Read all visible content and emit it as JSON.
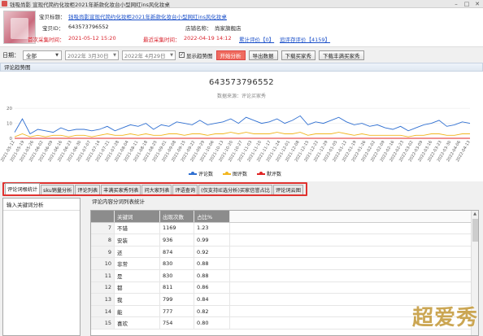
{
  "window": {
    "title": "钱吸尚影 宣现代简约化妆柜2021年新款化妆台小型网红ins风化妆桌"
  },
  "product": {
    "label_name": "宝贝标题：",
    "name": "钱吸尚影宣现代简约化妆柜2021年新款化妆台小型网红ins风化妆桌",
    "label_id": "宝贝ID：",
    "id": "643573796552",
    "label_shop": "店铺名称：",
    "shop": "尚家旗舰店",
    "label_first": "首次采集时间：",
    "first_time": "2021-05-12 15:20",
    "label_last": "最近采集时间：",
    "last_time": "2022-04-19 14:12",
    "review_link": "累计评价【0】",
    "ask_link": "追评存评价【4159】"
  },
  "toolbar": {
    "date_label": "日期：",
    "range_select": "全部",
    "date_start": "2022年 3月30日",
    "date_end": "2022年 4月29日",
    "show_trend_label": "显示趋势图",
    "show_trend_checked": true,
    "start_btn": "开始分析",
    "export_btn": "导出数据",
    "download_buyers_btn": "下载买家秀",
    "download_buyers_more_btn": "下载丰满买家秀"
  },
  "chart_section": {
    "title": "评论趋势图"
  },
  "chart_data": {
    "type": "line",
    "title": "643573796552",
    "subtitle": "数据来源：评论买家秀",
    "x_start": "2021-05-12",
    "x_end": "2022-04-13",
    "x_tick_labels": [
      "2021-05-12",
      "2021-05-19",
      "2021-05-26",
      "2021-06-02",
      "2021-06-09",
      "2021-06-16",
      "2021-06-23",
      "2021-06-30",
      "2021-07-07",
      "2021-07-14",
      "2021-07-21",
      "2021-07-28",
      "2021-08-04",
      "2021-08-11",
      "2021-08-18",
      "2021-08-25",
      "2021-09-01",
      "2021-09-08",
      "2021-09-15",
      "2021-09-22",
      "2021-09-29",
      "2021-10-06",
      "2021-10-13",
      "2021-10-20",
      "2021-10-27",
      "2021-11-03",
      "2021-11-10",
      "2021-11-17",
      "2021-11-24",
      "2021-12-01",
      "2021-12-08",
      "2021-12-15",
      "2021-12-22",
      "2021-12-29",
      "2022-01-05",
      "2022-01-12",
      "2022-01-19",
      "2022-01-26",
      "2022-02-02",
      "2022-02-09",
      "2022-02-16",
      "2022-02-23",
      "2022-03-02",
      "2022-03-09",
      "2022-03-16",
      "2022-03-23",
      "2022-03-30",
      "2022-04-06",
      "2022-04-13"
    ],
    "y_tick_labels": [
      "0",
      "10",
      "20"
    ],
    "ylim": [
      0,
      25
    ],
    "legend": "bottom",
    "series": [
      {
        "name": "评论数",
        "color": "#2f6fd1",
        "values": [
          4,
          13,
          3,
          6,
          5,
          4,
          7,
          5,
          6,
          6,
          5,
          6,
          8,
          5,
          7,
          9,
          8,
          10,
          6,
          9,
          8,
          11,
          10,
          9,
          12,
          9,
          10,
          11,
          13,
          10,
          14,
          12,
          10,
          11,
          13,
          10,
          12,
          15,
          9,
          11,
          10,
          12,
          14,
          11,
          9,
          10,
          8,
          9,
          7,
          6,
          8,
          5,
          7,
          9,
          10,
          12,
          8,
          9,
          11,
          10
        ]
      },
      {
        "name": "图评数",
        "color": "#f2b61f",
        "values": [
          1,
          3,
          1,
          2,
          1,
          2,
          2,
          1,
          2,
          2,
          1,
          2,
          3,
          2,
          2,
          3,
          2,
          3,
          2,
          2,
          3,
          3,
          2,
          3,
          3,
          2,
          3,
          3,
          4,
          3,
          4,
          3,
          3,
          3,
          4,
          3,
          3,
          4,
          2,
          3,
          3,
          3,
          4,
          3,
          2,
          3,
          2,
          2,
          2,
          2,
          2,
          1,
          2,
          2,
          3,
          3,
          2,
          2,
          3,
          3
        ]
      },
      {
        "name": "默评数",
        "color": "#e02424",
        "values": [
          0,
          0,
          0,
          0,
          0,
          0,
          0,
          0,
          0,
          0,
          0,
          0,
          0,
          0,
          0,
          0,
          0,
          0,
          0,
          0,
          0,
          0,
          0,
          0,
          0,
          0,
          0,
          0,
          0,
          0,
          0,
          0,
          0,
          0,
          0,
          0,
          0,
          0,
          0,
          0,
          0,
          0,
          0,
          0,
          0,
          0,
          0,
          0,
          0,
          0,
          0,
          0,
          0,
          0,
          0,
          0,
          0,
          0,
          0,
          0
        ]
      }
    ]
  },
  "tabs": [
    {
      "label": "评论词根统计",
      "active": true
    },
    {
      "label": "sku销量分析",
      "active": false
    },
    {
      "label": "评论列表",
      "active": false
    },
    {
      "label": "丰满买家秀列表",
      "active": false
    },
    {
      "label": "问大家列表",
      "active": false
    },
    {
      "label": "评语查询",
      "active": false
    },
    {
      "label": "(仅支持IE选分析)买家信誉占比",
      "active": false
    },
    {
      "label": "评论词云图",
      "active": false
    }
  ],
  "left_panel": {
    "title": "输入关键词分析"
  },
  "right_panel": {
    "title": "评论内容分词列表统计",
    "columns": [
      "",
      "关键词",
      "出现次数",
      "占比%"
    ],
    "rows": [
      [
        "7",
        "不错",
        "1169",
        "1.23"
      ],
      [
        "8",
        "安装",
        "936",
        "0.99"
      ],
      [
        "9",
        "还",
        "874",
        "0.92"
      ],
      [
        "10",
        "非常",
        "830",
        "0.88"
      ],
      [
        "11",
        "是",
        "830",
        "0.88"
      ],
      [
        "12",
        "都",
        "811",
        "0.86"
      ],
      [
        "13",
        "我",
        "799",
        "0.84"
      ],
      [
        "14",
        "能",
        "777",
        "0.82"
      ],
      [
        "15",
        "喜欢",
        "754",
        "0.80"
      ]
    ]
  },
  "watermark": "超爱秀"
}
